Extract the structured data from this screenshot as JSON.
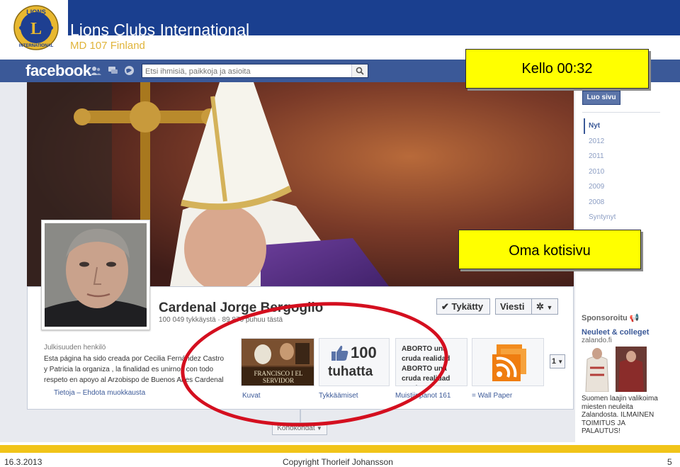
{
  "slide": {
    "org_title": "Lions Clubs International",
    "org_subtitle": "MD 107 Finland",
    "logo": "lions-logo-icon",
    "colors": {
      "header_band": "#1a3f8f",
      "footer_band": "#f1c419",
      "callout": "#ffff00",
      "highlight": "#d40f1f"
    }
  },
  "facebook": {
    "logo_text": "facebook",
    "nav_icons": [
      "friend-requests-icon",
      "messages-icon",
      "notifications-icon"
    ],
    "search_placeholder": "Etsi ihmisiä, paikkoja ja asioita",
    "brand_color": "#3b5998",
    "page": {
      "name": "Cardenal Jorge Bergoglio",
      "stats": "100 049 tykkäystä · 89 870 puhuu tästä",
      "liked_button": "Tykätty",
      "message_button": "Viesti",
      "about_label": "Julkisuuden henkilö",
      "about_text": "Esta página ha sido creada por Cecilia Fernández Castro y Patricia la organiza , la finalidad es unirnos con todo respeto en apoyo al Arzobispo de Buenos Aires Cardenal",
      "about_links": "Tietoja – Ehdota muokkausta",
      "apps": {
        "photos": {
          "label": "Kuvat",
          "caption": "FRANCISCO I EL SERVIDOR"
        },
        "likes": {
          "label": "Tykkäämiset",
          "number": "100",
          "unit": "tuhatta"
        },
        "notes": {
          "label": "Muistiinpanot 161",
          "text": "ABORTO una cruda realidad ABORTO una cruda realidad \"Todos tiene"
        },
        "wallpaper": {
          "label": "= Wall Paper"
        }
      },
      "more_apps_count": "1",
      "more_stories": "Kohokohdat"
    },
    "right_column": {
      "create_page_button": "Luo sivu",
      "years": [
        "Nyt",
        "2012",
        "2011",
        "2010",
        "2009",
        "2008",
        "Syntynyt"
      ],
      "active_year": "Nyt",
      "sponsored_title": "Sponsoroitu",
      "ad": {
        "title": "Neuleet & colleget",
        "domain": "zalando.fi",
        "text": "Suomen laajin valikoima miesten neuleita Zalandosta. ILMAINEN TOIMITUS JA PALAUTUS!"
      }
    }
  },
  "callouts": {
    "time": "Kello 00:32",
    "home": "Oma kotisivu"
  },
  "footer": {
    "date": "16.3.2013",
    "copyright": "Copyright Thorleif Johansson",
    "page_number": "5"
  }
}
